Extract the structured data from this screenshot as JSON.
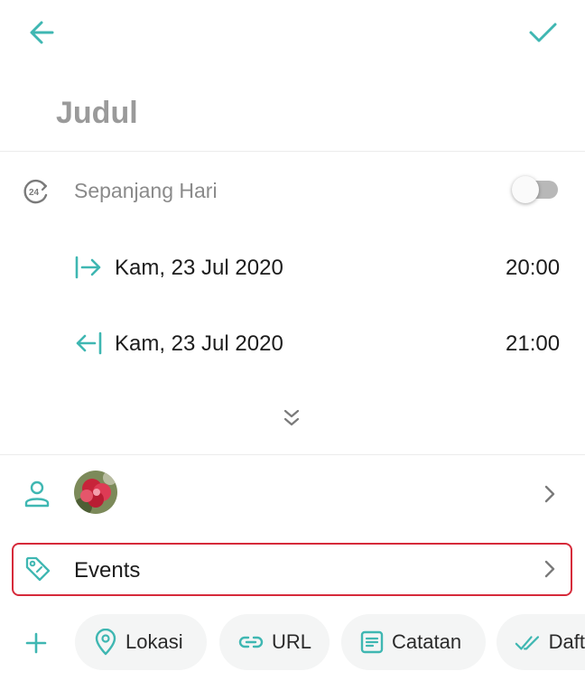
{
  "header": {
    "back_icon": "arrow-left-icon",
    "save_icon": "check-icon",
    "title_placeholder": "Judul",
    "accent_color": "#3fb7b2"
  },
  "all_day": {
    "label": "Sepanjang Hari",
    "icon": "clock-24-icon",
    "enabled": false
  },
  "start": {
    "date": "Kam, 23 Jul 2020",
    "time": "20:00",
    "icon": "arrow-right-bar-icon"
  },
  "end": {
    "date": "Kam, 23 Jul 2020",
    "time": "21:00",
    "icon": "arrow-left-bar-icon"
  },
  "expand_icon": "double-chevron-down-icon",
  "participants": {
    "icon": "person-icon",
    "avatar": "flower-avatar"
  },
  "category": {
    "label": "Events",
    "icon": "tag-icon"
  },
  "chips": [
    {
      "label": "Lokasi",
      "icon": "location-pin-icon"
    },
    {
      "label": "URL",
      "icon": "link-icon"
    },
    {
      "label": "Catatan",
      "icon": "notes-icon"
    },
    {
      "label": "Daft",
      "icon": "checklist-icon"
    }
  ],
  "add_icon": "plus-icon",
  "highlight_color": "#d62a3a"
}
